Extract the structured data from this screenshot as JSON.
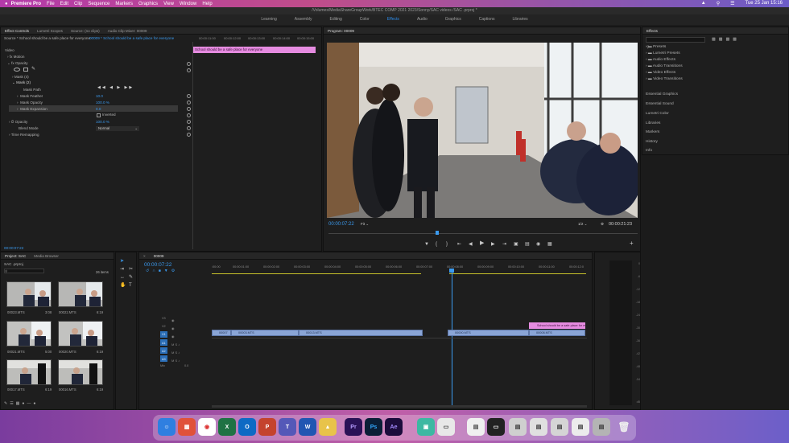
{
  "menubar": {
    "app": "Premiere Pro",
    "items": [
      "File",
      "Edit",
      "Clip",
      "Sequence",
      "Markers",
      "Graphics",
      "View",
      "Window",
      "Help"
    ],
    "clock": "Tue 25 Jan  15:16"
  },
  "title": "/Volumes/MediaShareGroupWork/BTEC COMP 2021 2023/Sonny/SAC videos /SAC .prproj *",
  "workspaces": {
    "items": [
      "Learning",
      "Assembly",
      "Editing",
      "Color",
      "Effects",
      "Audio",
      "Graphics",
      "Captions",
      "Libraries"
    ],
    "active": "Effects"
  },
  "effect_controls": {
    "tabs": [
      "Effect Controls",
      "Lumetri Scopes",
      "Source: (no clips)",
      "Audio Clip Mixer: 00009"
    ],
    "source_line": "Source * School should be a safe place for everyone",
    "sequence_line": "00009 * School should be a safe place for everyone",
    "ruler": [
      "00:00:11:00",
      "00:00:12:00",
      "00:00:13:00",
      "00:00:14:00",
      "00:00:15:00"
    ],
    "clip_bar": "School should be a safe place for everyone",
    "video_label": "Video",
    "motion": "Motion",
    "opacity": "Opacity",
    "mask4": "Mask (4)",
    "mask2": "Mask (2)",
    "mask_path": "Mask Path",
    "mask_feather_label": "Mask Feather",
    "mask_feather_value": "10.0",
    "mask_opacity_label": "Mask Opacity",
    "mask_opacity_value": "100.0 %",
    "mask_expansion_label": "Mask Expansion",
    "mask_expansion_value": "0.0",
    "inverted": "Inverted",
    "opacity2_label": "Opacity",
    "opacity2_value": "100.0 %",
    "blend_label": "Blend Mode",
    "blend_value": "Normal",
    "time_remapping": "Time Remapping",
    "timecode": "00:00:07:22"
  },
  "program": {
    "tab": "Program: 00009",
    "timecode": "00:00:07:22",
    "fit": "Fit",
    "quality": "1/2",
    "duration": "00:00:21:23"
  },
  "effects_panel": {
    "tab": "Effects",
    "folders": [
      "Presets",
      "Lumetri Presets",
      "Audio Effects",
      "Audio Transitions",
      "Video Effects",
      "Video Transitions"
    ],
    "panels": [
      "Essential Graphics",
      "Essential Sound",
      "Lumetri Color",
      "Libraries",
      "Markers",
      "History",
      "Info"
    ]
  },
  "project": {
    "tabs": [
      "Project: SAC",
      "Media Browser"
    ],
    "file": "SAC .prproj",
    "count": "26 items",
    "clips": [
      {
        "name": "00023.MTS",
        "duration": "3:08"
      },
      {
        "name": "00022.MTS",
        "duration": "6:19"
      },
      {
        "name": "00021.MTS",
        "duration": "5:00"
      },
      {
        "name": "00020.MTS",
        "duration": "6:19"
      },
      {
        "name": "00017.MTS",
        "duration": "6:19"
      },
      {
        "name": "00016.MTS",
        "duration": "6:19"
      }
    ]
  },
  "timeline": {
    "tab": "00009",
    "timecode": "00:00:07:22",
    "ruler": [
      ":00:00",
      "00:00:01:00",
      "00:00:02:00",
      "00:00:03:00",
      "00:00:04:00",
      "00:00:05:00",
      "00:00:06:00",
      "00:00:07:00",
      "00:00:08:00",
      "00:00:09:00",
      "00:00:10:00",
      "00:00:11:00",
      "00:00:12:0"
    ],
    "tracks": [
      "V3",
      "V2",
      "V1",
      "A1",
      "A2",
      "A3"
    ],
    "mix_label": "Mix",
    "mix_value": "0.0",
    "clips_v1": [
      "00007",
      "00003.MTS",
      "00013.MTS",
      "00000.MTS",
      "00008.MTS"
    ],
    "title_clip": "School should be a safe place for ever"
  },
  "audio_meter": {
    "ticks": [
      "0",
      "-6",
      "-12",
      "-18",
      "-24",
      "-30",
      "-36",
      "-42",
      "-48",
      "-54",
      "dB"
    ]
  },
  "dock": {
    "labels": [
      "Pr",
      "Ps",
      "Ae",
      "W"
    ]
  },
  "colors": {
    "accent": "#2d8ceb",
    "clip": "#8aa5d6",
    "title_clip": "#e58be0",
    "menubar": "#b33aa9"
  }
}
